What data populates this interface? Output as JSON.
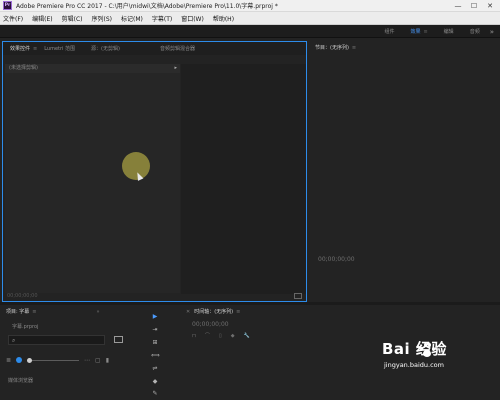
{
  "window": {
    "title": "Adobe Premiere Pro CC 2017 - C:\\用户\\midwi\\文档\\Adobe\\Premiere Pro\\11.0\\字幕.prproj *",
    "app_icon_text": "Pr",
    "minimize": "—",
    "maximize": "☐",
    "close": "✕"
  },
  "menu": [
    "文件(F)",
    "编辑(E)",
    "剪辑(C)",
    "序列(S)",
    "标记(M)",
    "字幕(T)",
    "窗口(W)",
    "帮助(H)"
  ],
  "workspaces": {
    "items": [
      "组件",
      "效果",
      "编辑",
      "音频"
    ],
    "active": "效果",
    "more": "»"
  },
  "source_panel": {
    "tabs": [
      "效果控件",
      "Lumetri 范围",
      "源：(无剪辑)",
      "音频剪辑混合器"
    ],
    "menu_glyph": "≡",
    "header": "(未选择剪辑)",
    "header_arrow": "▸",
    "timecode": "00;00;00;00"
  },
  "program_panel": {
    "tab": "节目：(无序列)",
    "menu_glyph": "≡",
    "timecode": "00;00;00;00"
  },
  "project_panel": {
    "tab": "项目: 字幕",
    "menu_glyph": "≡",
    "more": "»",
    "file": "字幕.prproj",
    "search_icon": "⌕",
    "media_browser": "媒体浏览器"
  },
  "timeline_panel": {
    "tab": "时间轴：(无序列)",
    "menu_glyph": "≡",
    "timecode": "00;00;00;00",
    "controls": [
      "⊓",
      "⌒",
      "▯",
      "◆",
      "🔧"
    ]
  },
  "tools": [
    "▶",
    "⇥",
    "⊞",
    "⟺",
    "⇌",
    "◆",
    "✎"
  ],
  "watermark": {
    "logo": "Bai  经验",
    "url": "jingyan.baidu.com"
  },
  "colors": {
    "accent": "#2d8ceb",
    "workspace_active": "#4b9cff",
    "panel_bg": "#232323"
  }
}
